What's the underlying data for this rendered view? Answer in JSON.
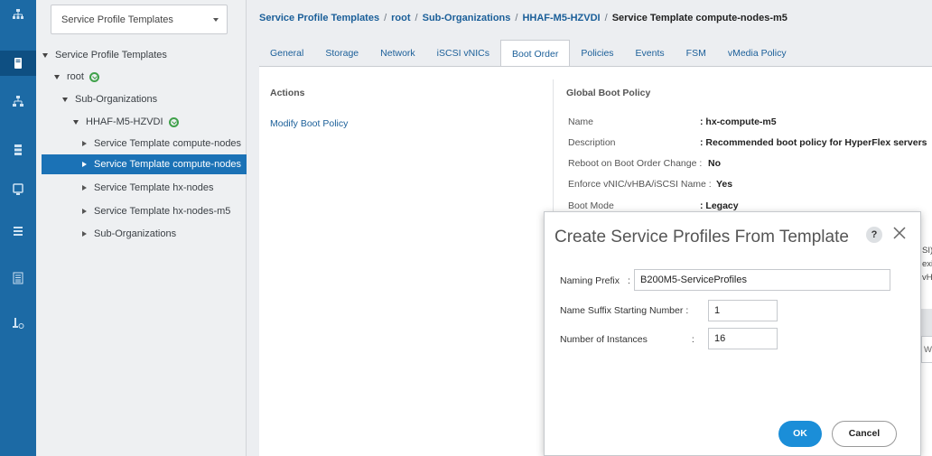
{
  "rail": {
    "icons": [
      "network-icon",
      "server-icon",
      "hierarchy-icon",
      "storage-icon",
      "monitor-icon",
      "list-icon",
      "list-lines-icon",
      "admin-icon"
    ],
    "active_index": 1
  },
  "tree": {
    "filter_select": "Service Profile Templates",
    "items": [
      {
        "label": "Service Profile Templates",
        "expanded": true
      },
      {
        "label": "root",
        "expanded": true
      },
      {
        "label": "Sub-Organizations",
        "expanded": true
      },
      {
        "label": "HHAF-M5-HZVDI",
        "expanded": true
      },
      {
        "label": "Service Template compute-nodes",
        "expanded": false
      },
      {
        "label": "Service Template compute-nodes",
        "expanded": false,
        "selected": true
      },
      {
        "label": "Service Template hx-nodes",
        "expanded": false
      },
      {
        "label": "Service Template hx-nodes-m5",
        "expanded": false
      },
      {
        "label": "Sub-Organizations",
        "expanded": false
      }
    ]
  },
  "breadcrumb": [
    "Service Profile Templates",
    "root",
    "Sub-Organizations",
    "HHAF-M5-HZVDI",
    "Service Template compute-nodes-m5"
  ],
  "tabs": [
    "General",
    "Storage",
    "Network",
    "iSCSI vNICs",
    "Boot Order",
    "Policies",
    "Events",
    "FSM",
    "vMedia Policy"
  ],
  "active_tab": "Boot Order",
  "actions": {
    "heading": "Actions",
    "modify_link": "Modify Boot Policy"
  },
  "boot_policy": {
    "heading": "Global Boot Policy",
    "rows": [
      {
        "label": "Name",
        "value": "hx-compute-m5"
      },
      {
        "label": "Description",
        "value": "Recommended boot policy for HyperFlex servers"
      },
      {
        "label": "Reboot on Boot Order Change",
        "value": "No"
      },
      {
        "label": "Enforce vNIC/vHBA/iSCSI Name",
        "value": "Yes"
      },
      {
        "label": "Boot Mode",
        "value": "Legacy"
      }
    ]
  },
  "clipped_fragments": [
    "SI) a",
    "exist",
    "vHBA",
    "WW"
  ],
  "modal": {
    "title": "Create Service Profiles From Template",
    "help_glyph": "?",
    "fields": {
      "naming_prefix": {
        "label": "Naming Prefix",
        "value": "B200M5-ServiceProfiles"
      },
      "suffix_start": {
        "label": "Name Suffix Starting Number",
        "value": "1"
      },
      "instances": {
        "label": "Number of Instances",
        "value": "16"
      }
    },
    "ok_label": "OK",
    "cancel_label": "Cancel"
  },
  "colors": {
    "rail": "#1c6aa5",
    "selection": "#1b72b6",
    "link": "#1b5f99",
    "ok_button": "#1b8ed8",
    "org_badge": "#3fa14a"
  }
}
